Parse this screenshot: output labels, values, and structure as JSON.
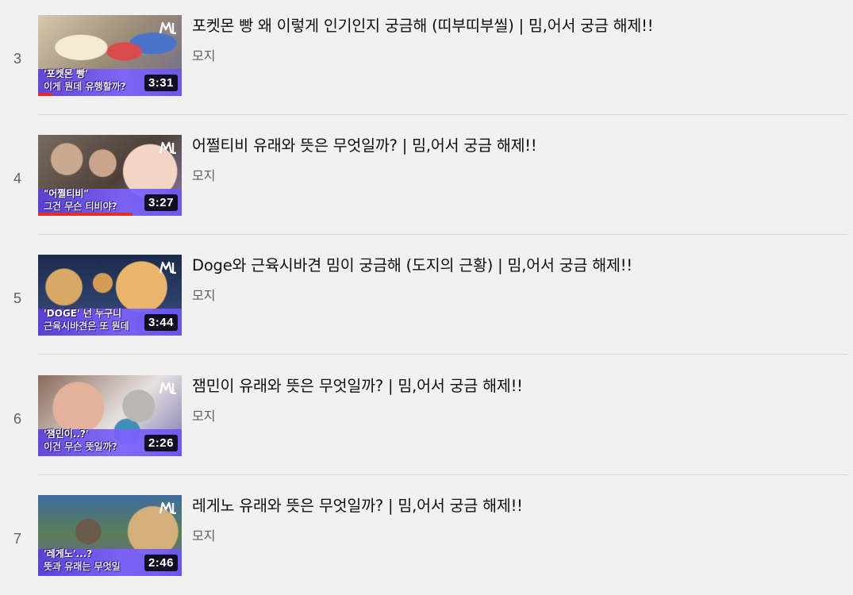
{
  "playlist": {
    "items": [
      {
        "index": "3",
        "title": "포켓몬 빵 왜 이렇게 인기인지 궁금해 (띠부띠부씰) | 밈,어서 궁금 해제!!",
        "channel": "모지",
        "duration": "3:31",
        "watched_fraction": 0.1,
        "thumb_caption_top": "'포켓몬 빵'",
        "thumb_caption_bottom": "이게 뭔데 유행할까?"
      },
      {
        "index": "4",
        "title": "어쩔티비 유래와 뜻은 무엇일까? | 밈,어서 궁금 해제!!",
        "channel": "모지",
        "duration": "3:27",
        "watched_fraction": 0.66,
        "thumb_caption_top": "\"어쩔티비\"",
        "thumb_caption_bottom": "그건 무슨 티비야?"
      },
      {
        "index": "5",
        "title": "Doge와 근육시바견 밈이 궁금해 (도지의 근황) | 밈,어서 궁금 해제!!",
        "channel": "모지",
        "duration": "3:44",
        "watched_fraction": 0,
        "thumb_caption_top": "'DOGE' 넌 누구니",
        "thumb_caption_bottom": "근육시바견은 또 뭔데"
      },
      {
        "index": "6",
        "title": "잼민이 유래와 뜻은 무엇일까? | 밈,어서 궁금 해제!!",
        "channel": "모지",
        "duration": "2:26",
        "watched_fraction": 0,
        "thumb_caption_top": "'잼민이..?'",
        "thumb_caption_bottom": "이건 무슨 뜻일까?"
      },
      {
        "index": "7",
        "title": "레게노 유래와 뜻은 무엇일까? | 밈,어서 궁금 해제!!",
        "channel": "모지",
        "duration": "2:46",
        "watched_fraction": 0,
        "thumb_caption_top": "'레게노'...?",
        "thumb_caption_bottom": "뜻과 유래는 무엇일"
      }
    ]
  },
  "colors": {
    "background": "#f1f1f1",
    "progress": "#e52d27",
    "thumb_band": "#6b55f0",
    "logo": "#ffffff"
  },
  "icons": {
    "channel_logo": "ml-logo-icon"
  }
}
